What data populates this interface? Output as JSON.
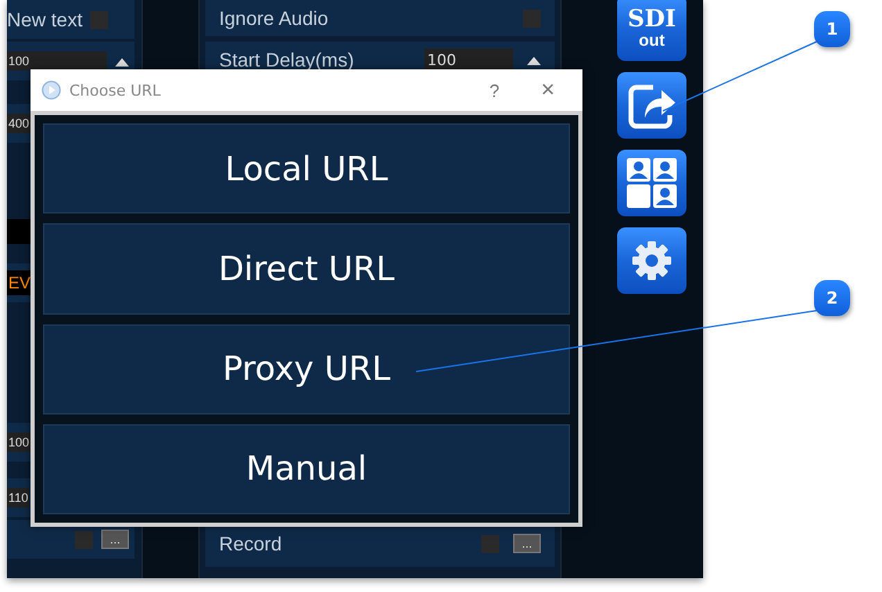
{
  "left_panel": {
    "rows": [
      {
        "kind": "label",
        "text": "New text",
        "checked": false
      },
      {
        "kind": "spin",
        "text": "100"
      },
      {
        "kind": "value",
        "text": "400"
      },
      {
        "kind": "warning",
        "text": "EV"
      },
      {
        "kind": "value",
        "text": "100"
      },
      {
        "kind": "value",
        "text": "110"
      },
      {
        "kind": "browse",
        "checked": false,
        "button": "..."
      }
    ]
  },
  "settings_panel": {
    "rows": [
      {
        "kind": "checkbox",
        "label": "Ignore Audio",
        "checked": false
      },
      {
        "kind": "spin",
        "label": "Start Delay(ms)",
        "value": "100"
      },
      {
        "kind": "browse",
        "label": "Record",
        "checked": false,
        "button": "..."
      }
    ]
  },
  "toolbar": [
    {
      "kind": "text",
      "title": "SDI",
      "subtitle": "out"
    },
    {
      "kind": "share"
    },
    {
      "kind": "layout"
    },
    {
      "kind": "settings"
    }
  ],
  "dialog": {
    "title": "Choose URL",
    "help": "?",
    "close": "×",
    "options": [
      "Local URL",
      "Direct URL",
      "Proxy URL",
      "Manual"
    ]
  },
  "callouts": [
    {
      "number": "1"
    },
    {
      "number": "2"
    }
  ]
}
